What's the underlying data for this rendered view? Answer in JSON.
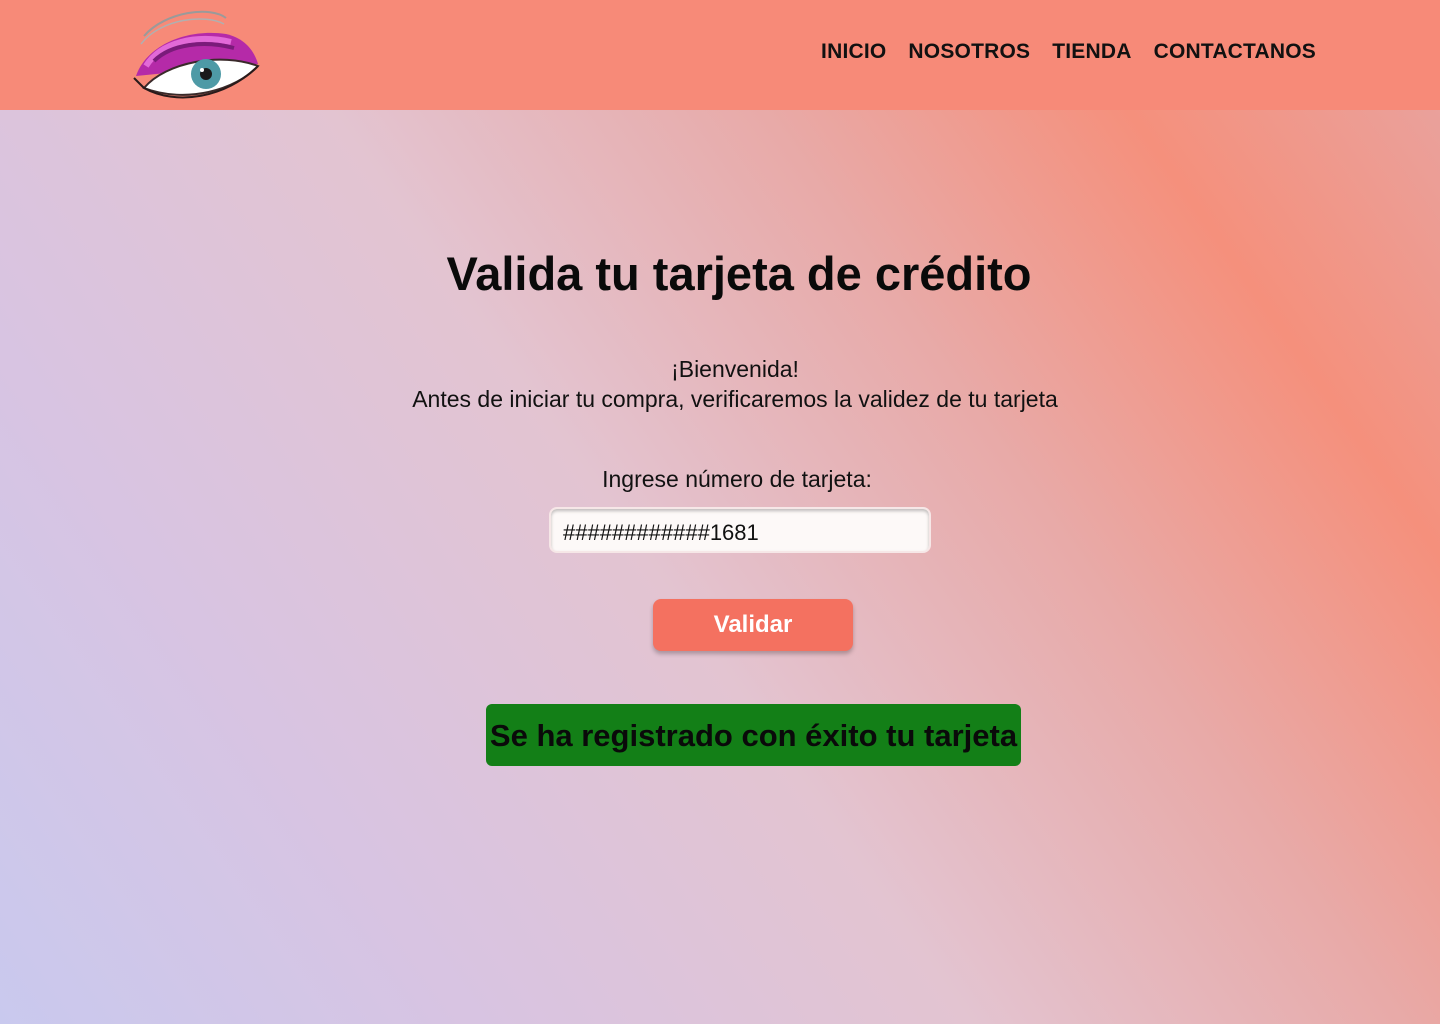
{
  "header": {
    "logo_icon": "painted-eye-logo-icon",
    "nav": [
      "INICIO",
      "NOSOTROS",
      "TIENDA",
      "CONTACTANOS"
    ]
  },
  "main": {
    "title": "Valida tu tarjeta de crédito",
    "welcome_line1": "¡Bienvenida!",
    "welcome_line2": "Antes de iniciar tu compra, verificaremos la validez de tu tarjeta",
    "card_label": "Ingrese número de tarjeta:",
    "card_value": "############1681",
    "validate_label": "Validar",
    "success_message": "Se ha registrado con éxito tu tarjeta"
  },
  "colors": {
    "header_bg": "#f78a78",
    "button_bg": "#f47160",
    "success_bg": "#137f17"
  }
}
